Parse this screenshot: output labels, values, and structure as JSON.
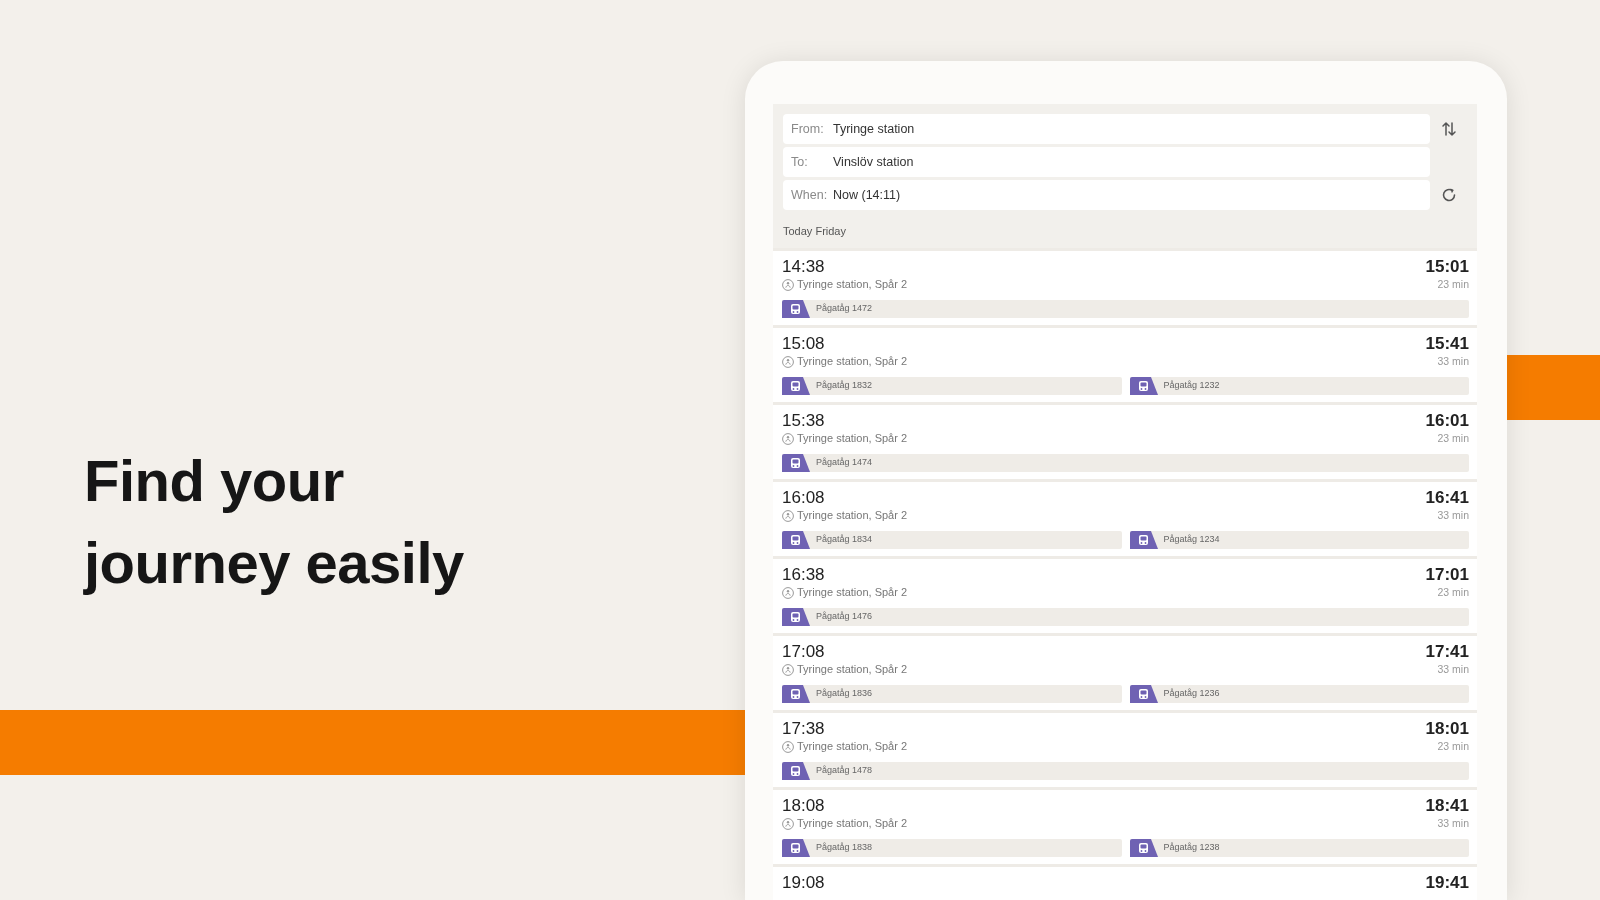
{
  "headline": "Find your journey easily",
  "search": {
    "fields": [
      {
        "label": "From:",
        "value": "Tyringe station"
      },
      {
        "label": "To:",
        "value": "Vinslöv station"
      },
      {
        "label": "When:",
        "value": "Now (14:11)"
      }
    ]
  },
  "date_heading": "Today Friday",
  "journeys": [
    {
      "departure": "14:38",
      "arrival": "15:01",
      "stop": "Tyringe station, Spår 2",
      "duration": "23 min",
      "trains": [
        "Pågatåg 1472"
      ]
    },
    {
      "departure": "15:08",
      "arrival": "15:41",
      "stop": "Tyringe station, Spår 2",
      "duration": "33 min",
      "trains": [
        "Pågatåg 1832",
        "Pågatåg 1232"
      ]
    },
    {
      "departure": "15:38",
      "arrival": "16:01",
      "stop": "Tyringe station, Spår 2",
      "duration": "23 min",
      "trains": [
        "Pågatåg 1474"
      ]
    },
    {
      "departure": "16:08",
      "arrival": "16:41",
      "stop": "Tyringe station, Spår 2",
      "duration": "33 min",
      "trains": [
        "Pågatåg 1834",
        "Pågatåg 1234"
      ]
    },
    {
      "departure": "16:38",
      "arrival": "17:01",
      "stop": "Tyringe station, Spår 2",
      "duration": "23 min",
      "trains": [
        "Pågatåg 1476"
      ]
    },
    {
      "departure": "17:08",
      "arrival": "17:41",
      "stop": "Tyringe station, Spår 2",
      "duration": "33 min",
      "trains": [
        "Pågatåg 1836",
        "Pågatåg 1236"
      ]
    },
    {
      "departure": "17:38",
      "arrival": "18:01",
      "stop": "Tyringe station, Spår 2",
      "duration": "23 min",
      "trains": [
        "Pågatåg 1478"
      ]
    },
    {
      "departure": "18:08",
      "arrival": "18:41",
      "stop": "Tyringe station, Spår 2",
      "duration": "33 min",
      "trains": [
        "Pågatåg 1838",
        "Pågatåg 1238"
      ]
    },
    {
      "departure": "19:08",
      "arrival": "19:41"
    }
  ]
}
